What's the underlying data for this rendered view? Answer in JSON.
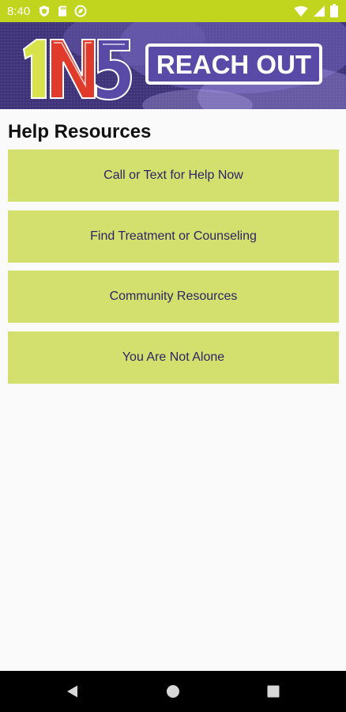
{
  "status_bar": {
    "time": "8:40",
    "background": "#c2d51e",
    "left_icons": [
      "shield-icon",
      "sd-card-icon",
      "data-saver-icon"
    ],
    "right_icons": [
      "wifi-icon",
      "signal-icon",
      "battery-icon"
    ]
  },
  "banner": {
    "logo_text": "1N5",
    "reach_out_label": "REACH OUT",
    "background": "#4b3f8c"
  },
  "main": {
    "title": "Help Resources",
    "buttons": [
      {
        "label": "Call or Text for Help Now"
      },
      {
        "label": "Find Treatment or Counseling"
      },
      {
        "label": "Community Resources"
      },
      {
        "label": "You Are Not Alone"
      }
    ],
    "button_color": "#d3e06e",
    "button_text_color": "#2d2466"
  },
  "nav_bar": {
    "buttons": [
      "back-icon",
      "home-icon",
      "recents-icon"
    ]
  }
}
